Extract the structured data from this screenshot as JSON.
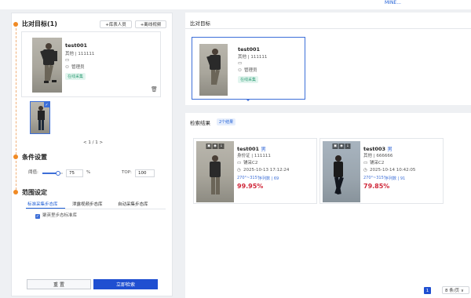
{
  "top_tabs": [
    "",
    "",
    "MINE..."
  ],
  "left": {
    "target_title": "比对目标(1)",
    "btn_add_person": "+库表人员",
    "btn_add_video": "+离线视频",
    "target": {
      "name": "test001",
      "category": "其他 | 111111",
      "owner": "管理员",
      "status": "在线采集"
    },
    "pager": "< 1 / 1 >",
    "conditions_title": "条件设置",
    "threshold_label": "阈值:",
    "threshold_value": "75",
    "threshold_pct": 0.75,
    "unit": "%",
    "top_label": "TOP:",
    "top_value": "100",
    "range_title": "范围设定",
    "range_tabs": [
      "标准采集步态库",
      "泄露视频步态库",
      "自动采集步态库"
    ],
    "range_option": "聚英里步态标准库",
    "btn_reset": "重 置",
    "btn_search": "立即检索"
  },
  "right": {
    "compare_title": "比对目标",
    "selected": {
      "name": "test001",
      "category": "其他 | 111111",
      "owner": "管理员",
      "status": "在线采集"
    },
    "results_title": "检索结果",
    "results_count": "2个结果",
    "results": [
      {
        "name": "test001",
        "gender": "男",
        "id_line": "身份证 | 111111",
        "location": "铺采C2",
        "time": "2025-10-13 17:12:24",
        "angle": "270°~315°",
        "seq": "序列数 | 69",
        "score": "99.95%"
      },
      {
        "name": "test003",
        "gender": "男",
        "id_line": "其他 | 666666",
        "location": "铺采C2",
        "time": "2025-10-14 10:42:05",
        "angle": "270°~315°",
        "seq": "序列数 | 91",
        "score": "79.85%"
      }
    ],
    "page": "1",
    "page_size": "8 条/页 ∨"
  }
}
